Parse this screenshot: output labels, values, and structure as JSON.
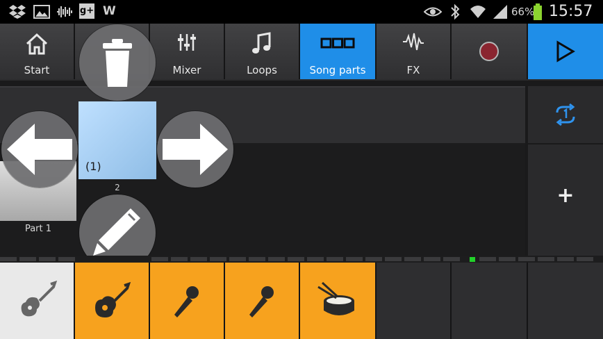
{
  "status_bar": {
    "battery_percent": "66%",
    "time": "15:57",
    "icons": [
      "dropbox-icon",
      "gallery-icon",
      "soundwave-icon",
      "google-plus-icon",
      "w-icon",
      "eye-icon",
      "bluetooth-icon",
      "wifi-icon",
      "signal-icon",
      "battery-icon"
    ],
    "w_letter": "W",
    "gplus_text": "g+"
  },
  "toolbar": {
    "items": [
      {
        "label": "Start",
        "icon": "home-icon"
      },
      {
        "label": "",
        "icon": ""
      },
      {
        "label": "Mixer",
        "icon": "mixer-icon"
      },
      {
        "label": "Loops",
        "icon": "music-note-icon"
      },
      {
        "label": "Song parts",
        "icon": "song-parts-icon",
        "active": true
      },
      {
        "label": "FX",
        "icon": "fx-wave-icon"
      },
      {
        "label": "",
        "icon": "record-icon"
      },
      {
        "label": "",
        "icon": "play-icon"
      }
    ],
    "accent_color": "#1f8ee8"
  },
  "parts": [
    {
      "label": "Part 1"
    },
    {
      "label": "2",
      "count": "(1)"
    }
  ],
  "side": {
    "loop_icon": "loop-1-icon",
    "add_label": "+"
  },
  "instruments": [
    {
      "icon": "electric-guitar-icon",
      "color": "#e9e9e9"
    },
    {
      "icon": "acoustic-guitar-icon",
      "color": "#f7a21e"
    },
    {
      "icon": "microphone-icon",
      "color": "#f7a21e"
    },
    {
      "icon": "microphone-icon",
      "color": "#f7a21e"
    },
    {
      "icon": "drum-icon",
      "color": "#f7a21e"
    },
    {
      "icon": "",
      "color": "#2e2e30"
    },
    {
      "icon": "",
      "color": "#2e2e30"
    },
    {
      "icon": "",
      "color": "#2e2e30"
    }
  ]
}
